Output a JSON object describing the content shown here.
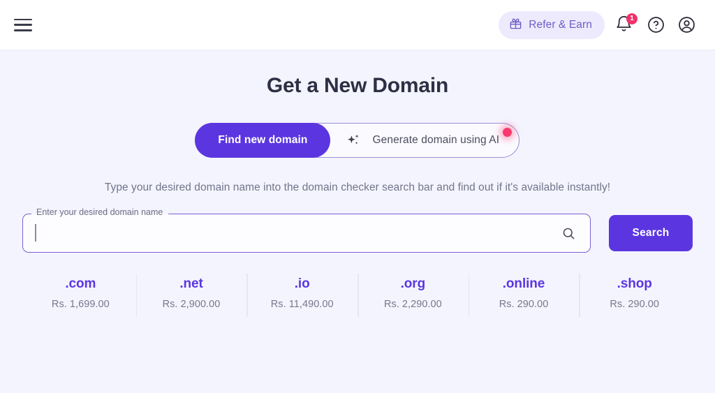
{
  "topbar": {
    "menu_icon": "hamburger-menu-icon",
    "refer": {
      "label": "Refer & Earn",
      "icon": "gift-icon"
    },
    "notifications": {
      "icon": "bell-icon",
      "badge_count": "1"
    },
    "help": {
      "icon": "help-circle-icon"
    },
    "account": {
      "icon": "user-avatar-icon"
    }
  },
  "main": {
    "title": "Get a New Domain",
    "toggle": {
      "find_label": "Find new domain",
      "generate_label": "Generate domain using AI",
      "generate_icon": "sparkle-ai-icon",
      "indicator": "pink-glow-dot"
    },
    "subtitle": "Type your desired domain name into the domain checker search bar and find out if it's available instantly!",
    "search": {
      "label": "Enter your desired domain name",
      "value": "",
      "placeholder": "",
      "icon": "search-magnifier-icon",
      "button_label": "Search"
    },
    "tlds": [
      {
        "name": ".com",
        "price": "Rs. 1,699.00"
      },
      {
        "name": ".net",
        "price": "Rs. 2,900.00"
      },
      {
        "name": ".io",
        "price": "Rs. 11,490.00"
      },
      {
        "name": ".org",
        "price": "Rs. 2,290.00"
      },
      {
        "name": ".online",
        "price": "Rs. 290.00"
      },
      {
        "name": ".shop",
        "price": "Rs. 290.00"
      }
    ]
  },
  "colors": {
    "brand_purple": "#5b36e0",
    "page_bg": "#f4f4fe",
    "accent_pink": "#f0326a",
    "refer_pill_bg": "#eeeafd",
    "title_color": "#2d3044"
  }
}
